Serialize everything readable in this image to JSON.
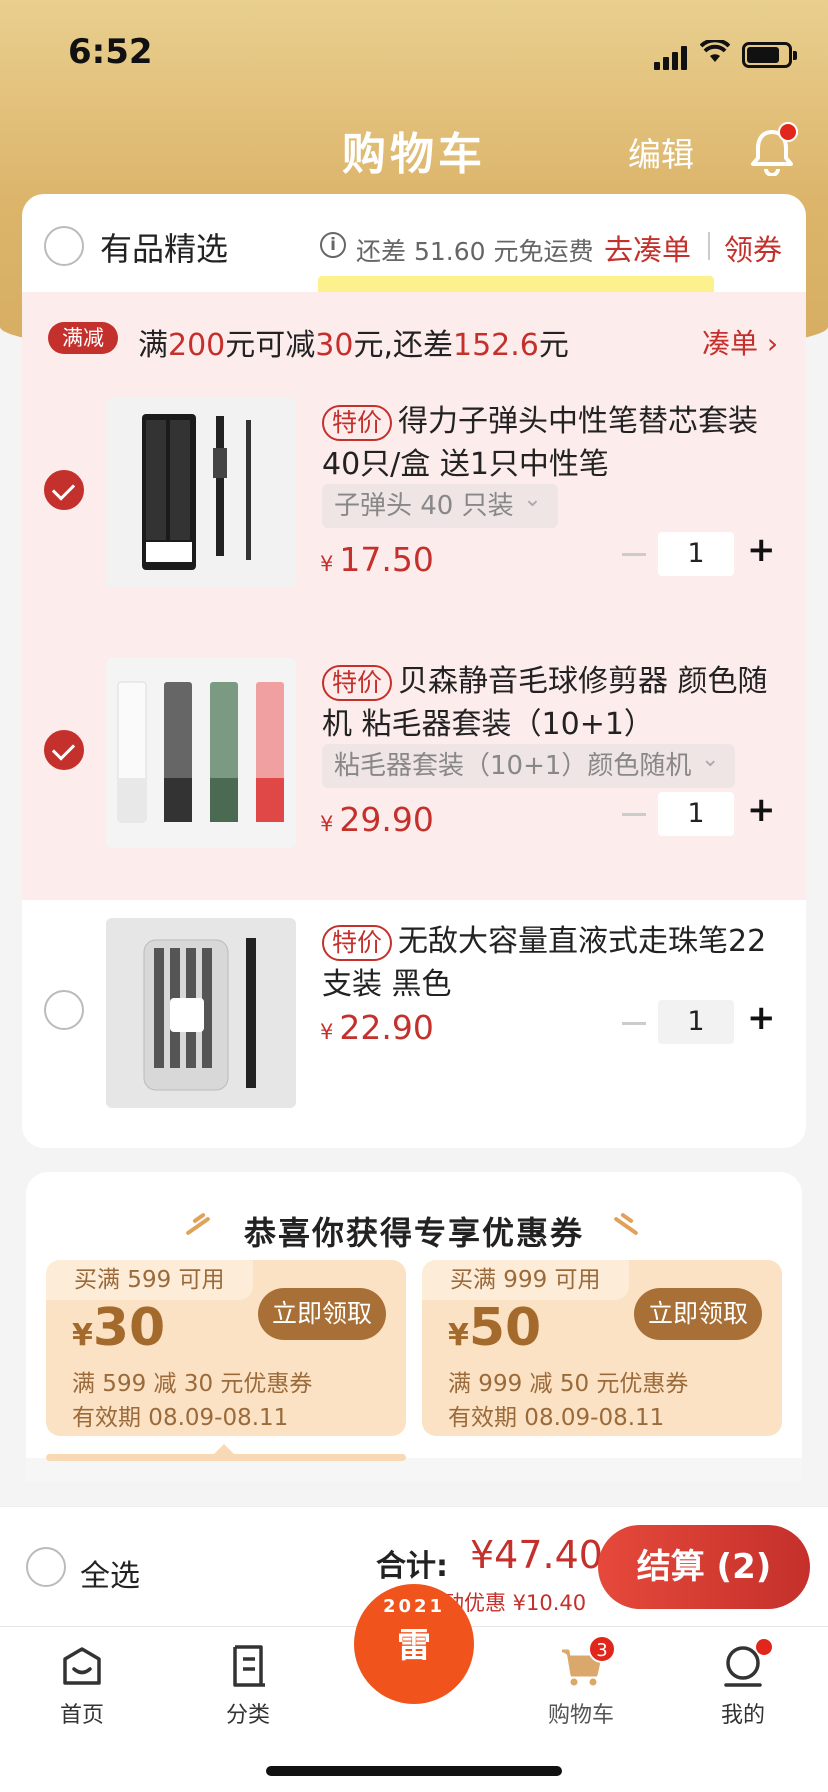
{
  "status": {
    "time": "6:52"
  },
  "header": {
    "title": "购物车",
    "edit_label": "编辑"
  },
  "shop": {
    "name": "有品精选",
    "shipping_note": "还差 51.60 元免运费",
    "goto_label": "去凑单",
    "coupon_label": "领券"
  },
  "promo": {
    "tag": "满减",
    "p1": "满",
    "v1": "200",
    "p2": "元可减",
    "v2": "30",
    "p3": "元,还差",
    "v3": "152.6",
    "p4": "元",
    "action": "凑单"
  },
  "items": [
    {
      "tag": "特价",
      "title": "得力子弹头中性笔替芯套装40只/盒 送1只中性笔",
      "spec": "子弹头 40 只装",
      "currency": "¥",
      "price": "17.50",
      "qty": "1",
      "checked": true
    },
    {
      "tag": "特价",
      "title": "贝森静音毛球修剪器 颜色随机 粘毛器套装（10+1）",
      "spec": "粘毛器套装（10+1）颜色随机",
      "currency": "¥",
      "price": "29.90",
      "qty": "1",
      "checked": true
    },
    {
      "tag": "特价",
      "title": "无敌大容量直液式走珠笔22支装 黑色",
      "spec": "",
      "currency": "¥",
      "price": "22.90",
      "qty": "1",
      "checked": false
    }
  ],
  "coupons": {
    "title": "恭喜你获得专享优惠券",
    "list": [
      {
        "limit": "买满 599 可用",
        "currency": "¥",
        "amount": "30",
        "button": "立即领取",
        "desc": "满 599 减 30 元优惠券",
        "expiry": "有效期 08.09-08.11"
      },
      {
        "limit": "买满 999 可用",
        "currency": "¥",
        "amount": "50",
        "button": "立即领取",
        "desc": "满 999 减 50 元优惠券",
        "expiry": "有效期 08.09-08.11"
      }
    ]
  },
  "checkout": {
    "select_all": "全选",
    "total_label": "合计:",
    "total_value": "¥47.40",
    "discount": "活动优惠 ¥10.40",
    "pay_label": "结算 (2)"
  },
  "tabbar": {
    "home": "首页",
    "category": "分类",
    "center_year": "2021",
    "center_label": "雷",
    "cart": "购物车",
    "cart_badge": "3",
    "mine": "我的"
  },
  "colors": {
    "accent": "#c4302b",
    "header_gold": "#dcb56b",
    "coupon_brown": "#a87036"
  }
}
